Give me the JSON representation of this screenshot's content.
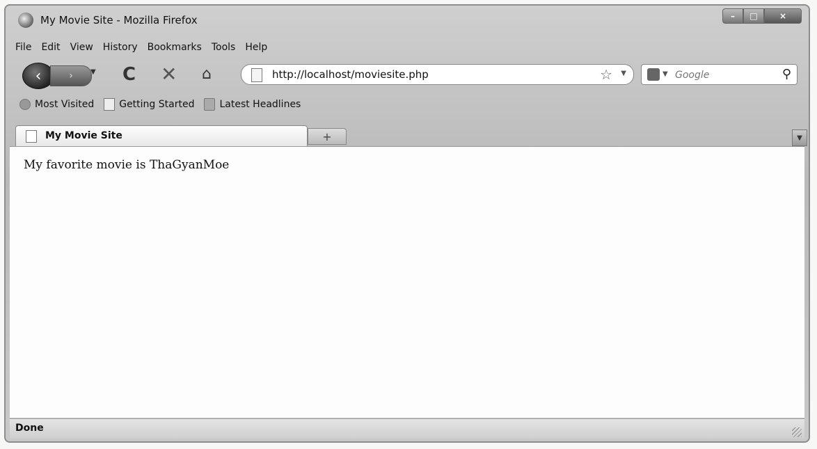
{
  "window": {
    "title": "My Movie Site - Mozilla Firefox",
    "controls": {
      "minimize": "–",
      "maximize": "□",
      "close": "×"
    }
  },
  "menu": [
    "File",
    "Edit",
    "View",
    "History",
    "Bookmarks",
    "Tools",
    "Help"
  ],
  "nav": {
    "back_icon": "‹",
    "forward_icon": "›",
    "reload_icon": "C",
    "stop_icon": "✕",
    "home_icon": "⌂",
    "url": "http://localhost/moviesite.php",
    "star_icon": "☆",
    "search_placeholder": "Google",
    "search_icon": "⚲"
  },
  "bookmarks": [
    "Most Visited",
    "Getting Started",
    "Latest Headlines"
  ],
  "tabs": [
    {
      "label": "My Movie Site"
    }
  ],
  "new_tab_label": "+",
  "page": {
    "text": "My favorite movie is ThaGyanMoe"
  },
  "status": {
    "text": "Done"
  }
}
